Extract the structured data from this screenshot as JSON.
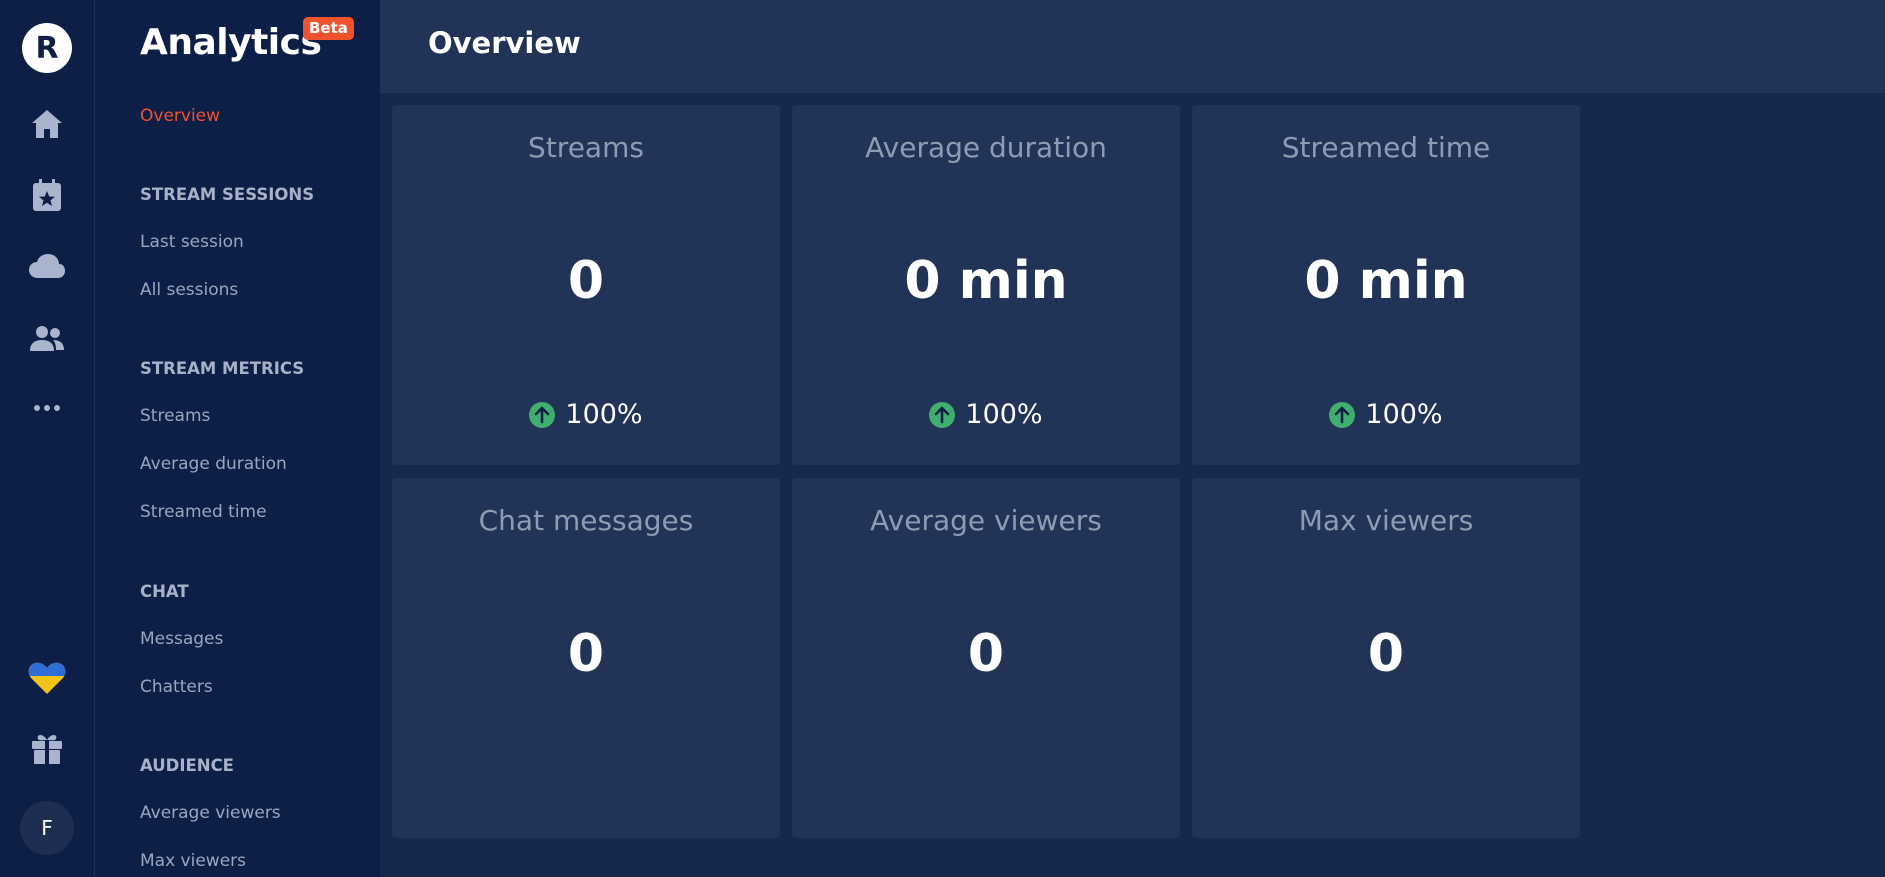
{
  "rail": {
    "logo_letter": "R",
    "icons": [
      "home-icon",
      "calendar-star-icon",
      "cloud-icon",
      "users-icon",
      "more-icon",
      "heart-icon",
      "gift-icon"
    ],
    "avatar_letter": "F",
    "colors": {
      "heart_top": "#2f6ed6",
      "heart_bottom": "#f0c419"
    }
  },
  "sidebar": {
    "app_title": "Analytics",
    "badge": "Beta",
    "overview": "Overview",
    "sections": [
      {
        "heading": "STREAM SESSIONS",
        "items": [
          "Last session",
          "All sessions"
        ]
      },
      {
        "heading": "STREAM METRICS",
        "items": [
          "Streams",
          "Average duration",
          "Streamed time"
        ]
      },
      {
        "heading": "CHAT",
        "items": [
          "Messages",
          "Chatters"
        ]
      },
      {
        "heading": "AUDIENCE",
        "items": [
          "Average viewers",
          "Max viewers"
        ]
      }
    ]
  },
  "header": {
    "title": "Overview"
  },
  "cards": [
    {
      "title": "Streams",
      "value": "0",
      "change": "100%"
    },
    {
      "title": "Average duration",
      "value": "0 min",
      "change": "100%"
    },
    {
      "title": "Streamed time",
      "value": "0 min",
      "change": "100%"
    },
    {
      "title": "Chat messages",
      "value": "0"
    },
    {
      "title": "Average viewers",
      "value": "0"
    },
    {
      "title": "Max viewers",
      "value": "0"
    }
  ],
  "colors": {
    "accent": "#f0522e",
    "positive": "#3fae6e",
    "background": "#16294d",
    "card": "#213457"
  }
}
